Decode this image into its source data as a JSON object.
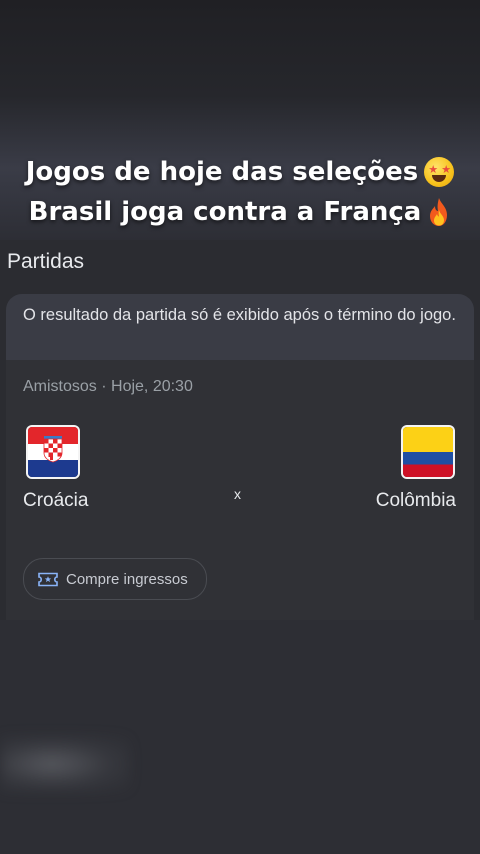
{
  "banner": {
    "line1": "Jogos de hoje das seleções",
    "line1_emoji": "star-struck-emoji",
    "line2": "Brasil joga contra a França",
    "line2_emoji": "fire-emoji"
  },
  "section": {
    "title": "Partidas"
  },
  "card": {
    "notice": "O resultado da partida só é exibido após o término do jogo.",
    "meta": "Amistosos · Hoje, 20:30",
    "home_team": "Croácia",
    "away_team": "Colômbia",
    "separator": "x",
    "ticket_label": "Compre ingressos"
  },
  "colors": {
    "background": "#2c2d33",
    "card": "#303136",
    "notice_bg": "#3a3c45",
    "text_primary": "#e8eaed",
    "text_secondary": "#9aa0a6"
  }
}
